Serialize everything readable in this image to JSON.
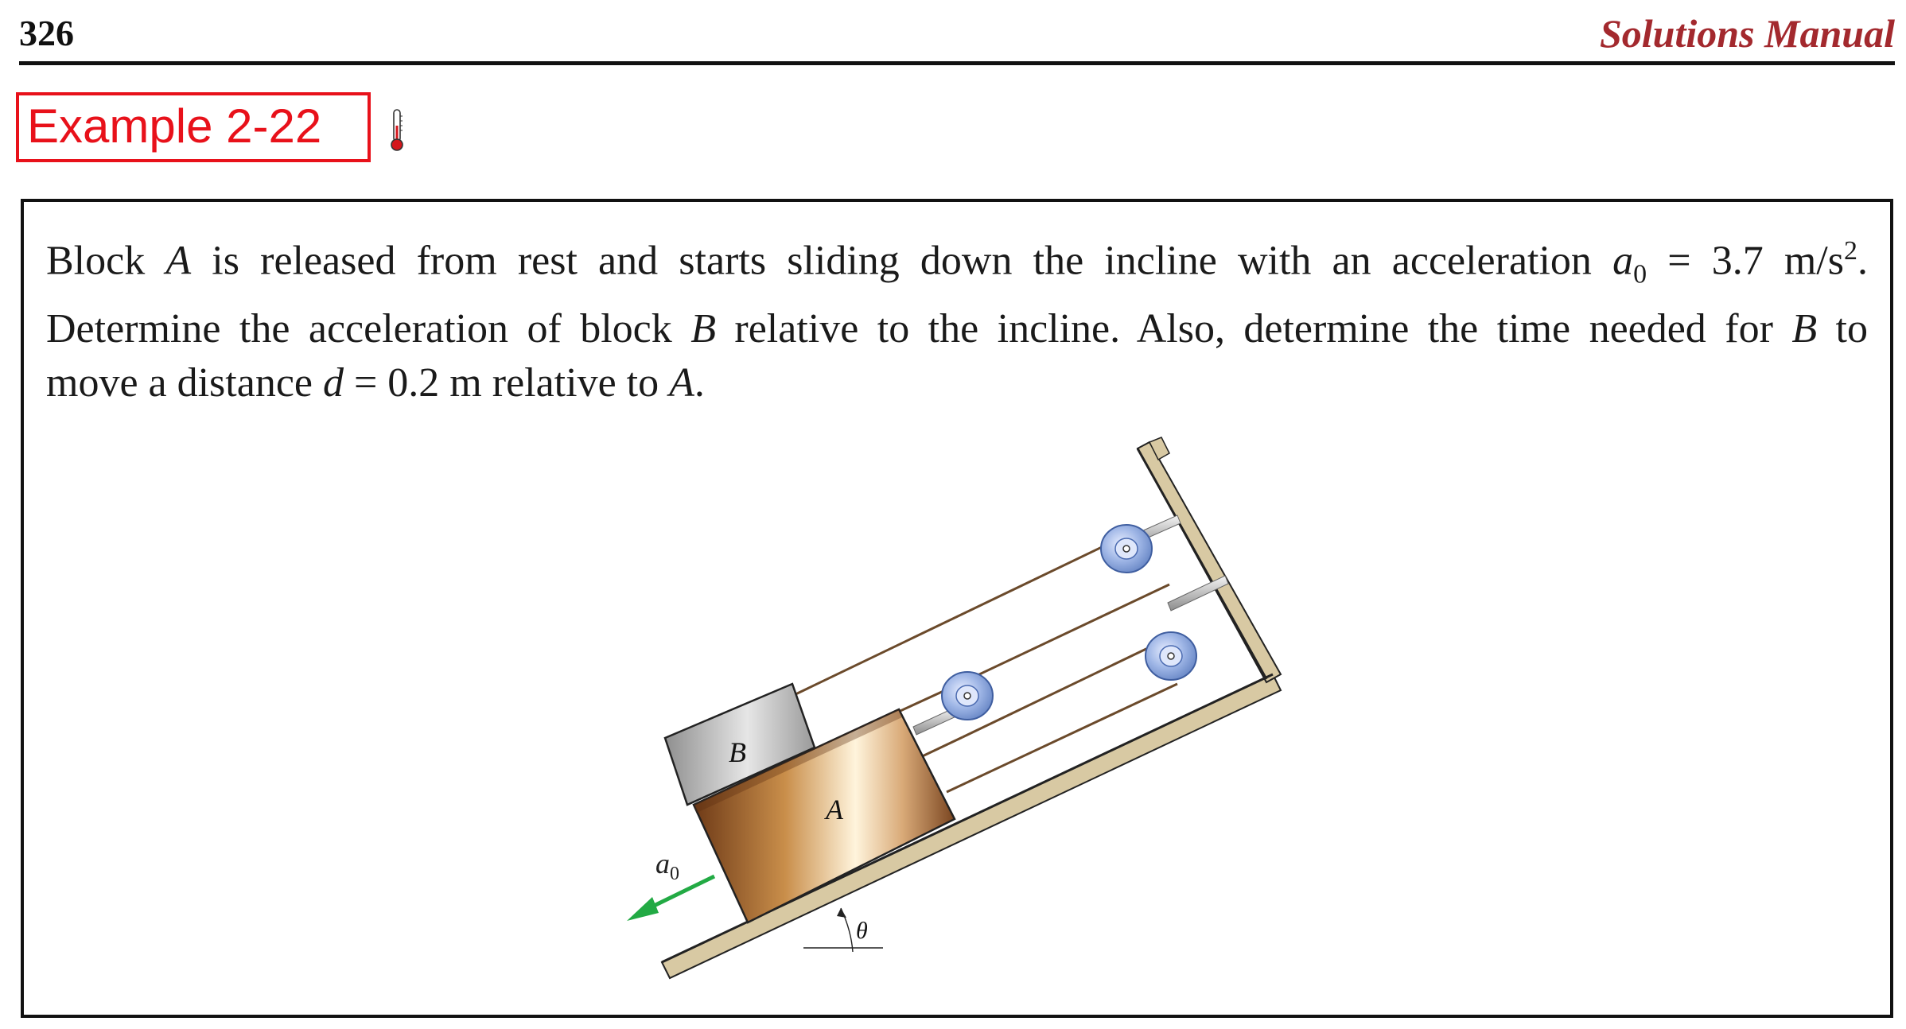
{
  "header": {
    "page_number": "326",
    "manual_title": "Solutions Manual"
  },
  "example": {
    "label": "Example 2-22",
    "icon": "thermometer-icon"
  },
  "problem": {
    "line1": {
      "t1": "Block ",
      "v1": "A",
      "t2": " is released from rest and starts sliding down the incline with an acceleration ",
      "v2": "a",
      "sub": "0",
      "t3": " = 3.7 m/s",
      "sup": "2",
      "t4": "."
    },
    "line2": {
      "t1": "Determine the acceleration of block ",
      "v1": "B",
      "t2": " relative to the incline. Also, determine the time needed for ",
      "v2": "B",
      "t3": " to"
    },
    "line3": {
      "t1": "move a distance ",
      "v1": "d",
      "t2": " = 0.2 m relative to ",
      "v2": "A",
      "t3": "."
    }
  },
  "figure": {
    "label_block_a": "A",
    "label_block_b": "B",
    "label_accel": "a",
    "label_accel_sub": "0",
    "label_angle": "θ",
    "colors": {
      "incline": "#d8c9a3",
      "cable": "#6b4a2b",
      "pulley": "#7f9fd6",
      "arrow": "#22aa44",
      "block_b": "#bdbdbd"
    }
  }
}
